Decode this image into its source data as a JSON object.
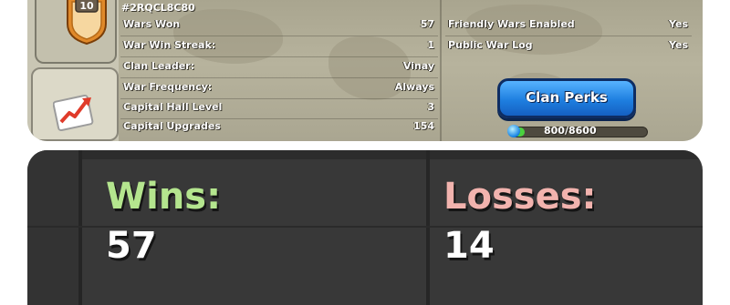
{
  "clan": {
    "level": "10",
    "tag": "#2RQCL8C80"
  },
  "stats_left": [
    {
      "label": "Wars Won",
      "value": "57"
    },
    {
      "label": "War Win Streak:",
      "value": "1"
    },
    {
      "label": "Clan Leader:",
      "value": "Vinay"
    },
    {
      "label": "War Frequency:",
      "value": "Always"
    },
    {
      "label": "Capital Hall Level",
      "value": "3"
    },
    {
      "label": "Capital Upgrades",
      "value": "154"
    }
  ],
  "stats_right": [
    {
      "label": "Friendly Wars Enabled",
      "value": "Yes"
    },
    {
      "label": "Public War Log",
      "value": "Yes"
    }
  ],
  "perks_button": {
    "label": "Clan Perks"
  },
  "xp": {
    "text": "800/8600",
    "current": 800,
    "max": 8600
  },
  "summary": {
    "wins_label": "Wins:",
    "wins_value": "57",
    "losses_label": "Losses:",
    "losses_value": "14"
  },
  "colors": {
    "accent_button": "#1e7fe0",
    "wins_label": "#b4e58e",
    "losses_label": "#f2b3ae",
    "xp_fill": "#4ad13e"
  },
  "icons": {
    "badge": "clan-level-shield-icon",
    "progress": "growth-chart-icon",
    "xp": "xp-orb-icon"
  }
}
